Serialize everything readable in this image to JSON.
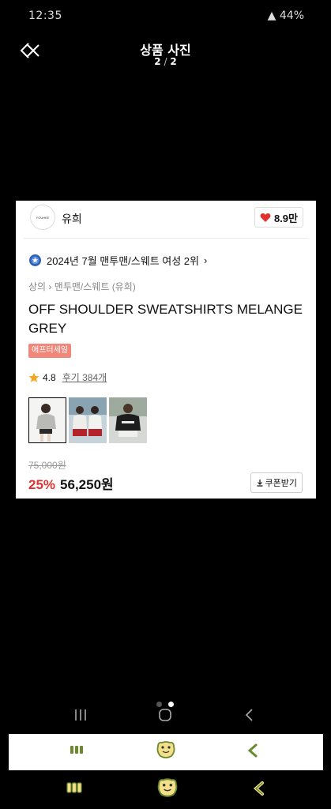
{
  "status_bar": {
    "time": "12:35",
    "battery": "44%"
  },
  "header": {
    "title": "상품 사진",
    "page_current": "2",
    "page_total": "2"
  },
  "product": {
    "brand": "유희",
    "brand_logo_text": "YOUHEE",
    "likes": "8.9만",
    "ranking": "2024년 7월 맨투맨/스웨트 여성 2위",
    "breadcrumb": [
      "상의",
      "맨투맨/스웨트 (유희)"
    ],
    "title": "OFF SHOULDER SWEATSHIRTS MELANGE GREY",
    "sale_tag": "애프터세일",
    "rating": "4.8",
    "reviews": "후기 384개",
    "original_price": "75,000원",
    "discount": "25%",
    "price": "56,250원",
    "coupon_label": "쿠폰받기"
  },
  "colors": {
    "accent_red": "#e0322f",
    "sale_tag": "#f1877a",
    "nav_green": "#6b8a2e"
  },
  "icons": {
    "close": "close-icon",
    "heart": "heart-icon",
    "ranking": "rank-badge-icon",
    "star": "star-icon",
    "download": "download-icon"
  },
  "pager_dots": {
    "count": 2,
    "active_index": 1
  }
}
